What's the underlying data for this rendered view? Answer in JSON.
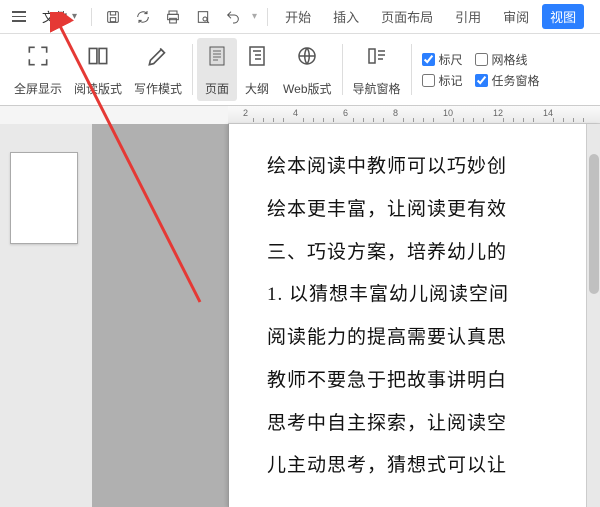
{
  "topbar": {
    "file_label": "文件",
    "tabs": {
      "start": "开始",
      "insert": "插入",
      "layout": "页面布局",
      "reference": "引用",
      "review": "审阅",
      "view": "视图"
    }
  },
  "ribbon": {
    "fullscreen": "全屏显示",
    "reading_mode": "阅读版式",
    "writing_mode": "写作模式",
    "page_view": "页面",
    "outline": "大纲",
    "web_view": "Web版式",
    "nav_pane": "导航窗格",
    "ruler": "标尺",
    "gridlines": "网格线",
    "marks": "标记",
    "task_pane": "任务窗格"
  },
  "ruler_ticks": [
    "2",
    "4",
    "6",
    "8",
    "10",
    "12",
    "14"
  ],
  "document": {
    "lines": [
      "绘本阅读中教师可以巧妙创",
      "绘本更丰富，让阅读更有效",
      "三、巧设方案，培养幼儿的",
      "1. 以猜想丰富幼儿阅读空间",
      "阅读能力的提高需要认真思",
      "教师不要急于把故事讲明白",
      "思考中自主探索，让阅读空",
      "儿主动思考，猜想式可以让"
    ]
  },
  "checked": {
    "ruler": true,
    "gridlines": false,
    "marks": false,
    "task_pane": true
  }
}
